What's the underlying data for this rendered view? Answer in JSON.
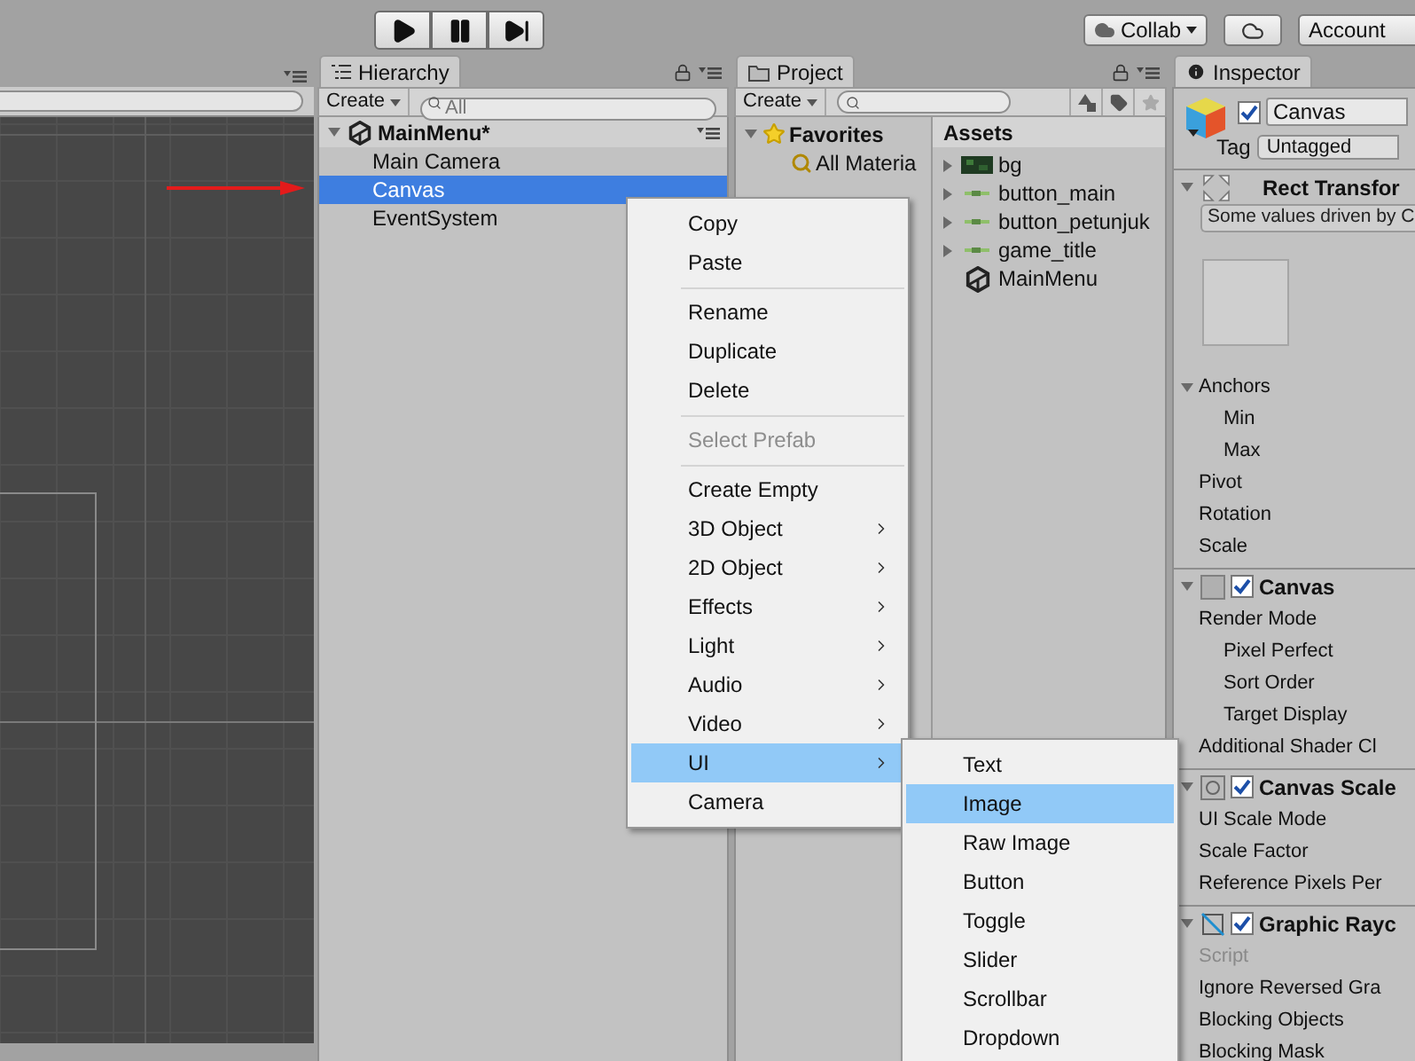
{
  "toolbar": {
    "collab": "Collab",
    "account": "Account"
  },
  "hierarchy": {
    "tab": "Hierarchy",
    "create": "Create",
    "search_placeholder": "All",
    "scene": {
      "name": "MainMenu*",
      "expanded": true
    },
    "items": [
      {
        "label": "Main Camera",
        "selected": false
      },
      {
        "label": "Canvas",
        "selected": true
      },
      {
        "label": "EventSystem",
        "selected": false
      }
    ]
  },
  "project": {
    "tab": "Project",
    "create": "Create",
    "favorites": {
      "label": "Favorites",
      "expanded": true,
      "items": [
        "All Materia"
      ]
    },
    "assets_title": "Assets",
    "assets": [
      {
        "name": "bg",
        "kind": "texture",
        "expandable": true
      },
      {
        "name": "button_main",
        "kind": "sprite",
        "expandable": true
      },
      {
        "name": "button_petunjuk",
        "kind": "sprite",
        "expandable": true
      },
      {
        "name": "game_title",
        "kind": "sprite",
        "expandable": true
      },
      {
        "name": "MainMenu",
        "kind": "scene",
        "expandable": false
      }
    ]
  },
  "inspector": {
    "tab": "Inspector",
    "active": true,
    "name": "Canvas",
    "tag_label": "Tag",
    "tag": "Untagged",
    "components": [
      {
        "kind": "rect_transform",
        "title": "Rect Transfor",
        "expanded": true,
        "note": "Some values driven by C",
        "rows": [
          {
            "kind": "foldout",
            "label": "Anchors",
            "expanded": true,
            "children": [
              {
                "kind": "field",
                "label": "Min"
              },
              {
                "kind": "field",
                "label": "Max"
              }
            ]
          },
          {
            "kind": "field",
            "label": "Pivot"
          },
          {
            "kind": "field",
            "label": "Rotation"
          },
          {
            "kind": "field",
            "label": "Scale"
          }
        ]
      },
      {
        "kind": "canvas",
        "title": "Canvas",
        "expanded": true,
        "enabled": true,
        "rows": [
          {
            "kind": "field",
            "label": "Render Mode",
            "children": [
              {
                "kind": "field",
                "label": "Pixel Perfect"
              },
              {
                "kind": "field",
                "label": "Sort Order"
              },
              {
                "kind": "field",
                "label": "Target Display"
              }
            ]
          },
          {
            "kind": "field",
            "label": "Additional Shader Cl"
          }
        ]
      },
      {
        "kind": "canvas_scaler",
        "title": "Canvas Scale",
        "expanded": true,
        "enabled": true,
        "rows": [
          {
            "kind": "field",
            "label": "UI Scale Mode"
          },
          {
            "kind": "field",
            "label": "Scale Factor"
          },
          {
            "kind": "field",
            "label": "Reference Pixels Per"
          }
        ]
      },
      {
        "kind": "graphic_raycaster",
        "title": "Graphic Rayc",
        "expanded": true,
        "enabled": true,
        "rows": [
          {
            "kind": "field",
            "label": "Script",
            "disabled": true
          },
          {
            "kind": "field",
            "label": "Ignore Reversed Gra",
            "disabled": false
          },
          {
            "kind": "field",
            "label": "Blocking Objects",
            "disabled": false
          },
          {
            "kind": "field",
            "label": "Blocking Mask",
            "disabled": false
          }
        ]
      }
    ]
  },
  "context_menu": {
    "items": [
      {
        "kind": "item",
        "label": "Copy",
        "selected": false,
        "disabled": false
      },
      {
        "kind": "item",
        "label": "Paste",
        "selected": false,
        "disabled": false
      },
      {
        "kind": "separator"
      },
      {
        "kind": "item",
        "label": "Rename",
        "selected": false,
        "disabled": false
      },
      {
        "kind": "item",
        "label": "Duplicate",
        "selected": false,
        "disabled": false
      },
      {
        "kind": "item",
        "label": "Delete",
        "selected": false,
        "disabled": false
      },
      {
        "kind": "separator"
      },
      {
        "kind": "item",
        "label": "Select Prefab",
        "selected": false,
        "disabled": true
      },
      {
        "kind": "separator"
      },
      {
        "kind": "item",
        "label": "Create Empty",
        "selected": false,
        "disabled": false
      },
      {
        "kind": "submenu",
        "label": "3D Object",
        "selected": false,
        "disabled": false
      },
      {
        "kind": "submenu",
        "label": "2D Object",
        "selected": false,
        "disabled": false
      },
      {
        "kind": "submenu",
        "label": "Effects",
        "selected": false,
        "disabled": false
      },
      {
        "kind": "submenu",
        "label": "Light",
        "selected": false,
        "disabled": false
      },
      {
        "kind": "submenu",
        "label": "Audio",
        "selected": false,
        "disabled": false
      },
      {
        "kind": "submenu",
        "label": "Video",
        "selected": false,
        "disabled": false
      },
      {
        "kind": "submenu",
        "label": "UI",
        "selected": true,
        "disabled": false
      },
      {
        "kind": "item",
        "label": "Camera",
        "selected": false,
        "disabled": false
      }
    ]
  },
  "submenu": {
    "items": [
      {
        "label": "Text",
        "selected": false
      },
      {
        "label": "Image",
        "selected": true
      },
      {
        "label": "Raw Image",
        "selected": false
      },
      {
        "label": "Button",
        "selected": false
      },
      {
        "label": "Toggle",
        "selected": false
      },
      {
        "label": "Slider",
        "selected": false
      },
      {
        "label": "Scrollbar",
        "selected": false
      },
      {
        "label": "Dropdown",
        "selected": false
      }
    ]
  }
}
